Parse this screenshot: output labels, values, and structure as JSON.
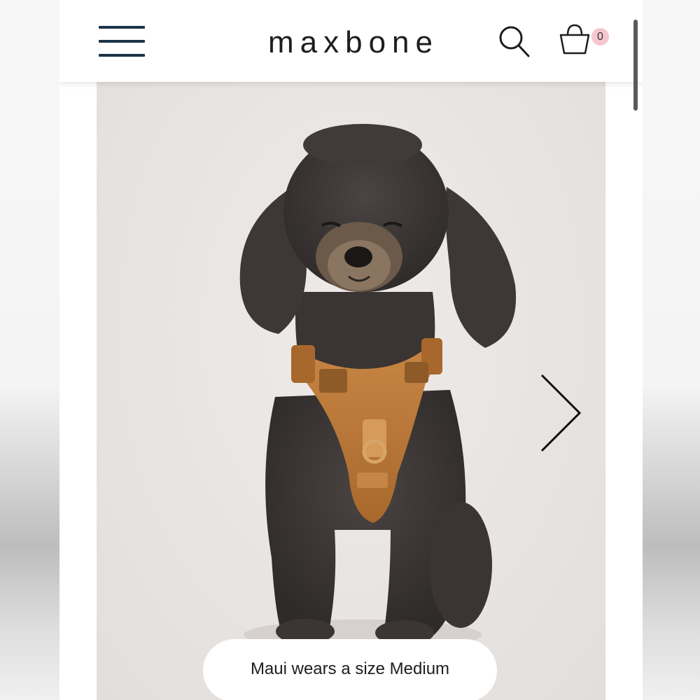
{
  "header": {
    "logo": "maxbone",
    "cart_count": "0",
    "icons": {
      "menu": "hamburger-menu-icon",
      "search": "search-icon",
      "cart": "shopping-bag-icon"
    }
  },
  "gallery": {
    "caption": "Maui wears a size Medium",
    "image_subject": "poodle-wearing-harness",
    "next_icon": "chevron-right-icon"
  },
  "colors": {
    "navy": "#1c3347",
    "badge": "#f6c7cf",
    "harness": "#b87535",
    "fur": "#3f3a38"
  }
}
